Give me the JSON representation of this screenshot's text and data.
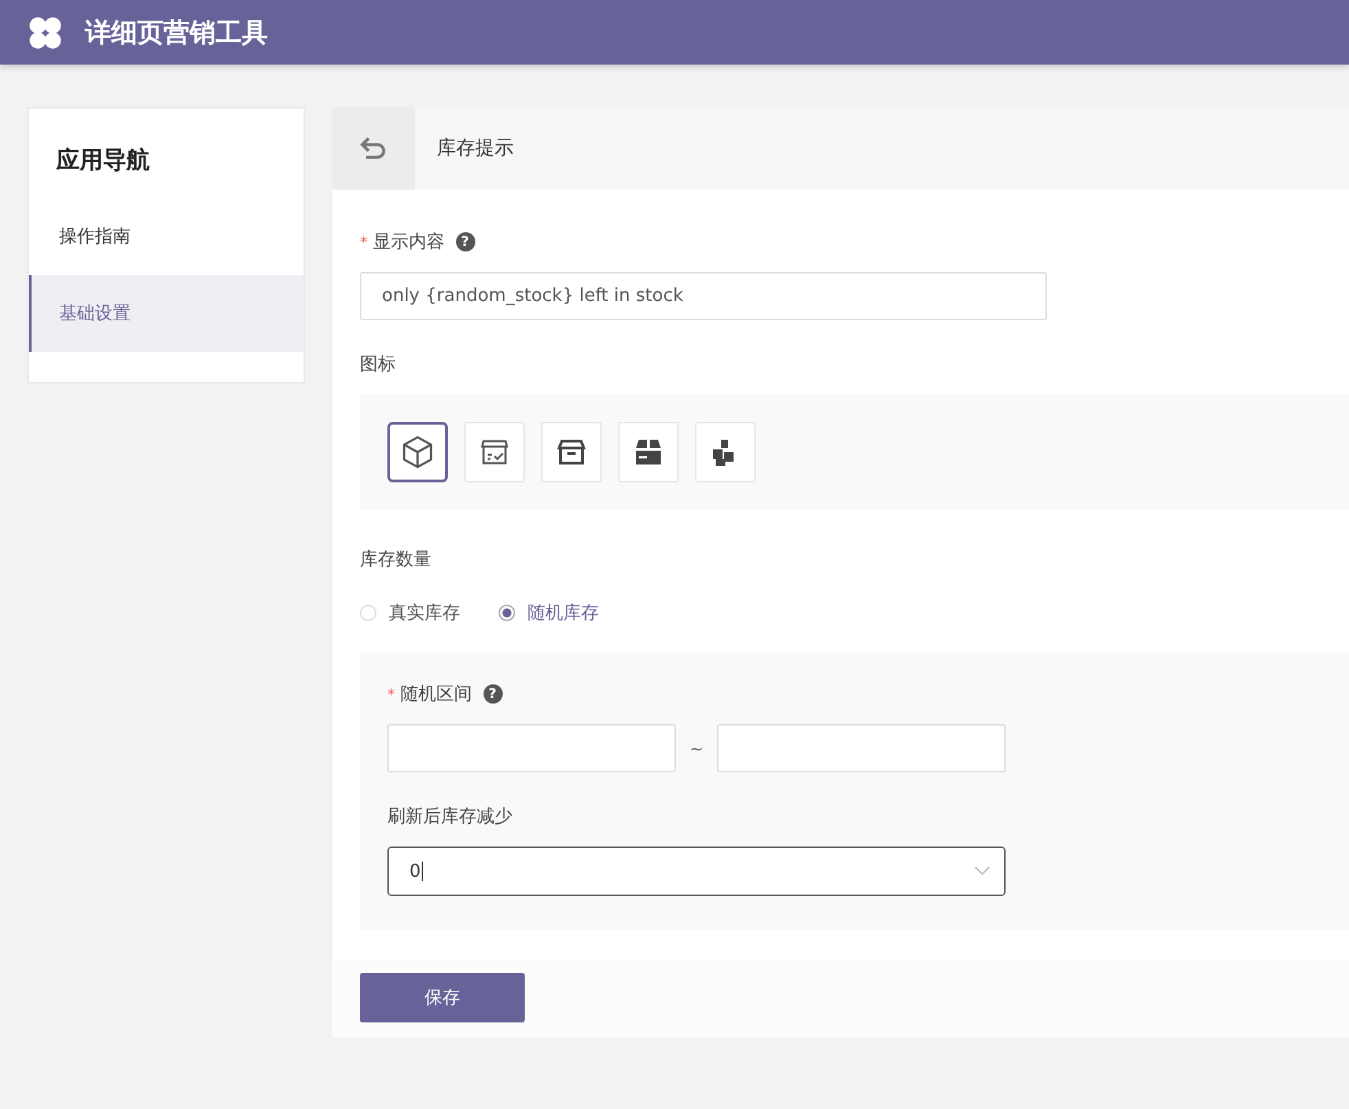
{
  "app": {
    "title": "详细页营销工具"
  },
  "sidebar": {
    "title": "应用导航",
    "items": [
      {
        "label": "操作指南",
        "selected": false
      },
      {
        "label": "基础设置",
        "selected": true
      }
    ]
  },
  "panel": {
    "title": "库存提示"
  },
  "form": {
    "content": {
      "label": "显示内容",
      "required_mark": "*",
      "help": "?",
      "value": "only {random_stock} left in stock"
    },
    "icon_picker": {
      "label": "图标",
      "options": [
        {
          "kind": "cube",
          "selected": true
        },
        {
          "kind": "box-check",
          "selected": false
        },
        {
          "kind": "archive",
          "selected": false
        },
        {
          "kind": "package",
          "selected": false
        },
        {
          "kind": "boxes",
          "selected": false
        }
      ]
    },
    "stock": {
      "label": "库存数量",
      "options": [
        {
          "label": "真实库存",
          "selected": false
        },
        {
          "label": "随机库存",
          "selected": true
        }
      ]
    },
    "range": {
      "label": "随机区间",
      "required_mark": "*",
      "help": "?",
      "separator": "~"
    },
    "decrease": {
      "label": "刷新后库存减少",
      "value": "0"
    },
    "save": "保存"
  }
}
